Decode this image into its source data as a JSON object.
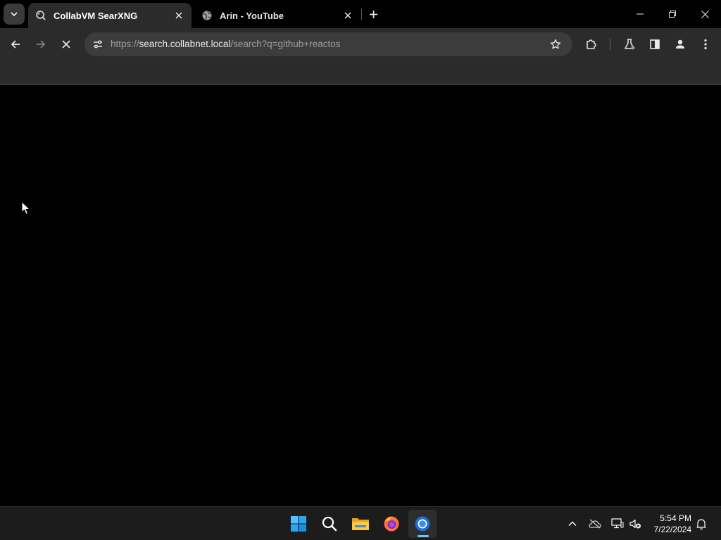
{
  "tabs": [
    {
      "title": "CollabVM SearXNG",
      "active": true,
      "icon": "searxng-icon"
    },
    {
      "title": "Arin - YouTube",
      "active": false,
      "icon": "globe-icon"
    }
  ],
  "omnibox": {
    "scheme": "https://",
    "host": "search.collabnet.local",
    "path": "/search?q=github+reactos"
  },
  "colors": {
    "tab_active_bg": "#2b2b2b",
    "toolbar_bg": "#2b2b2b",
    "omnibox_bg": "#3c3c3c",
    "content_bg": "#000000",
    "taskbar_bg": "#1c1c1c",
    "accent": "#60cdff"
  },
  "taskbar": {
    "apps": [
      "start-icon",
      "search-icon",
      "file-explorer-icon",
      "firefox-icon",
      "chrome-icon"
    ],
    "tray": [
      "chevron-up-icon",
      "onedrive-icon",
      "network-icon",
      "volume-muted-icon",
      "notifications-icon"
    ],
    "time": "5:54 PM",
    "date": "7/22/2024"
  }
}
